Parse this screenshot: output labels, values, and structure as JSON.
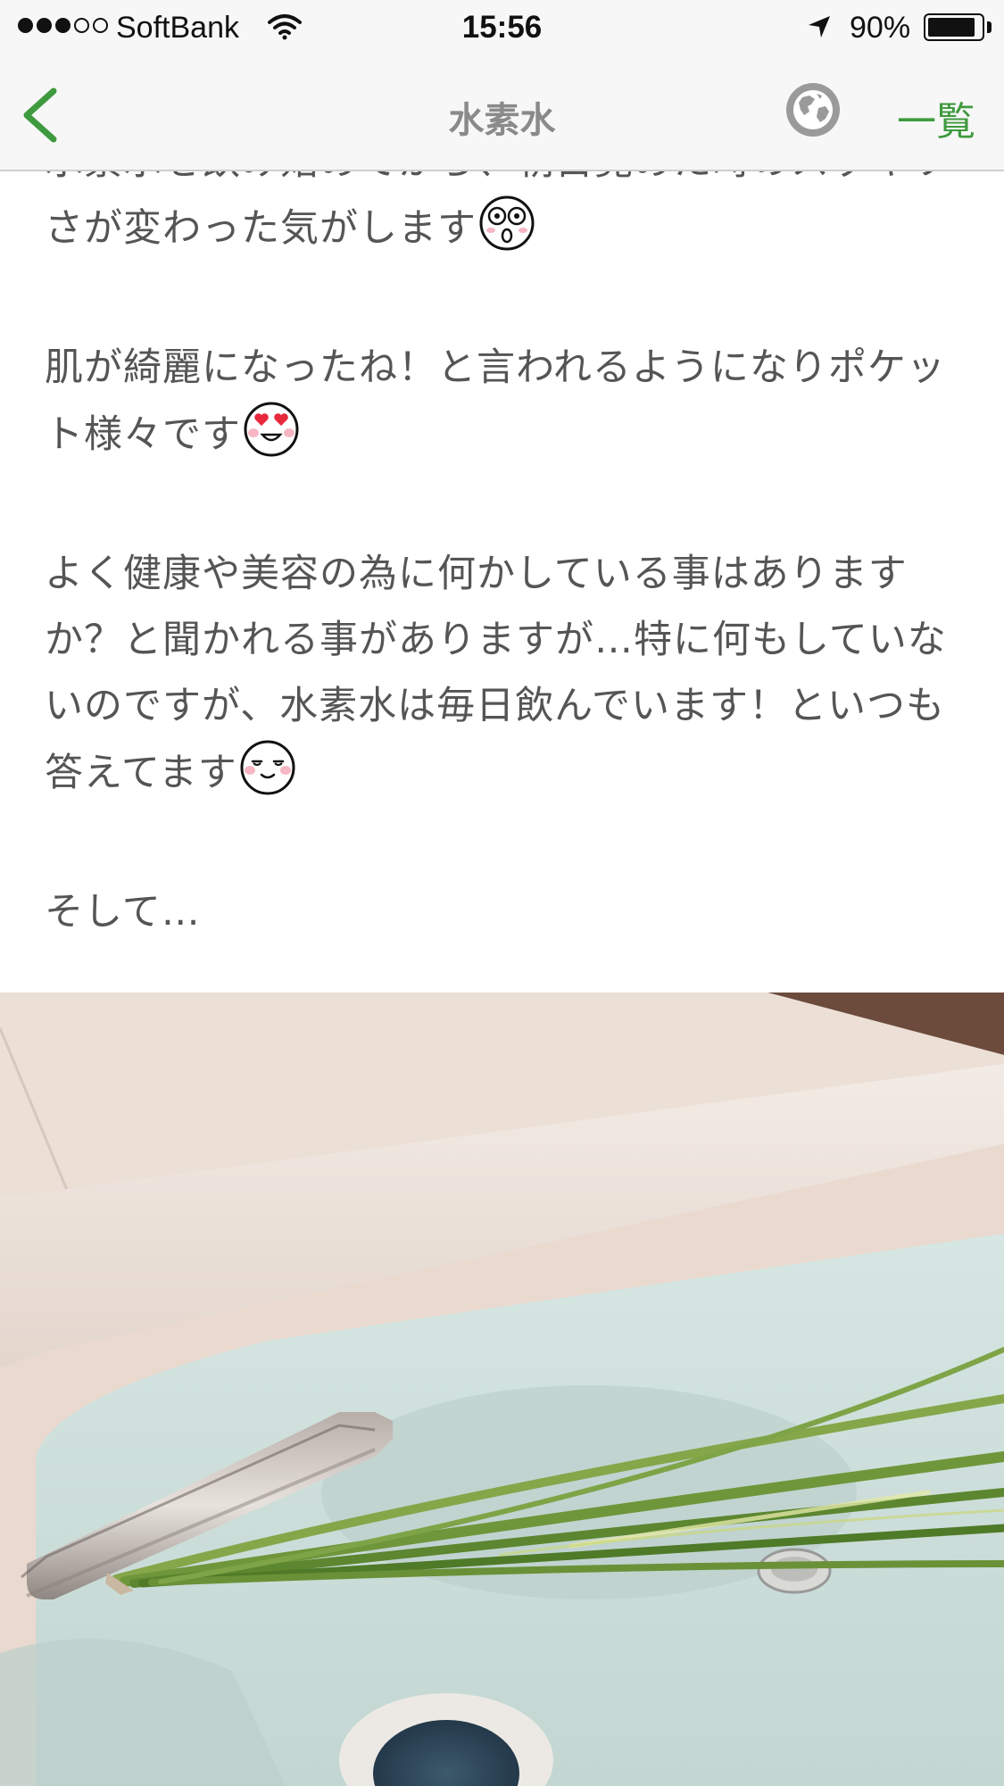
{
  "status_bar": {
    "carrier": "SoftBank",
    "time": "15:56",
    "battery_percent": "90%",
    "battery_level": 0.9,
    "signal_bars_filled": 3,
    "signal_bars_total": 5
  },
  "nav": {
    "title": "水素水",
    "right_link": "一覧",
    "back_icon": "chevron-left",
    "globe_icon": "globe",
    "accent_color": "#3f9a3f"
  },
  "article": {
    "paragraphs": [
      {
        "text": "水素水を飲み始めてから、朝目覚めた時のスッキリさが変わった気がします",
        "emoji": "surprised-face"
      },
      {
        "text": "肌が綺麗になったね！と言われるようになりポケット様々です",
        "emoji": "heart-eyes-face"
      },
      {
        "text": "よく健康や美容の為に何かしている事はありますか？と聞かれる事がありますが…特に何もしていないのですが、水素水は毎日飲んでいます！といつも答えてます",
        "emoji": "content-face"
      },
      {
        "text": "そして…",
        "emoji": null
      }
    ]
  },
  "photo": {
    "subject": "bathtub-with-green-onion"
  }
}
